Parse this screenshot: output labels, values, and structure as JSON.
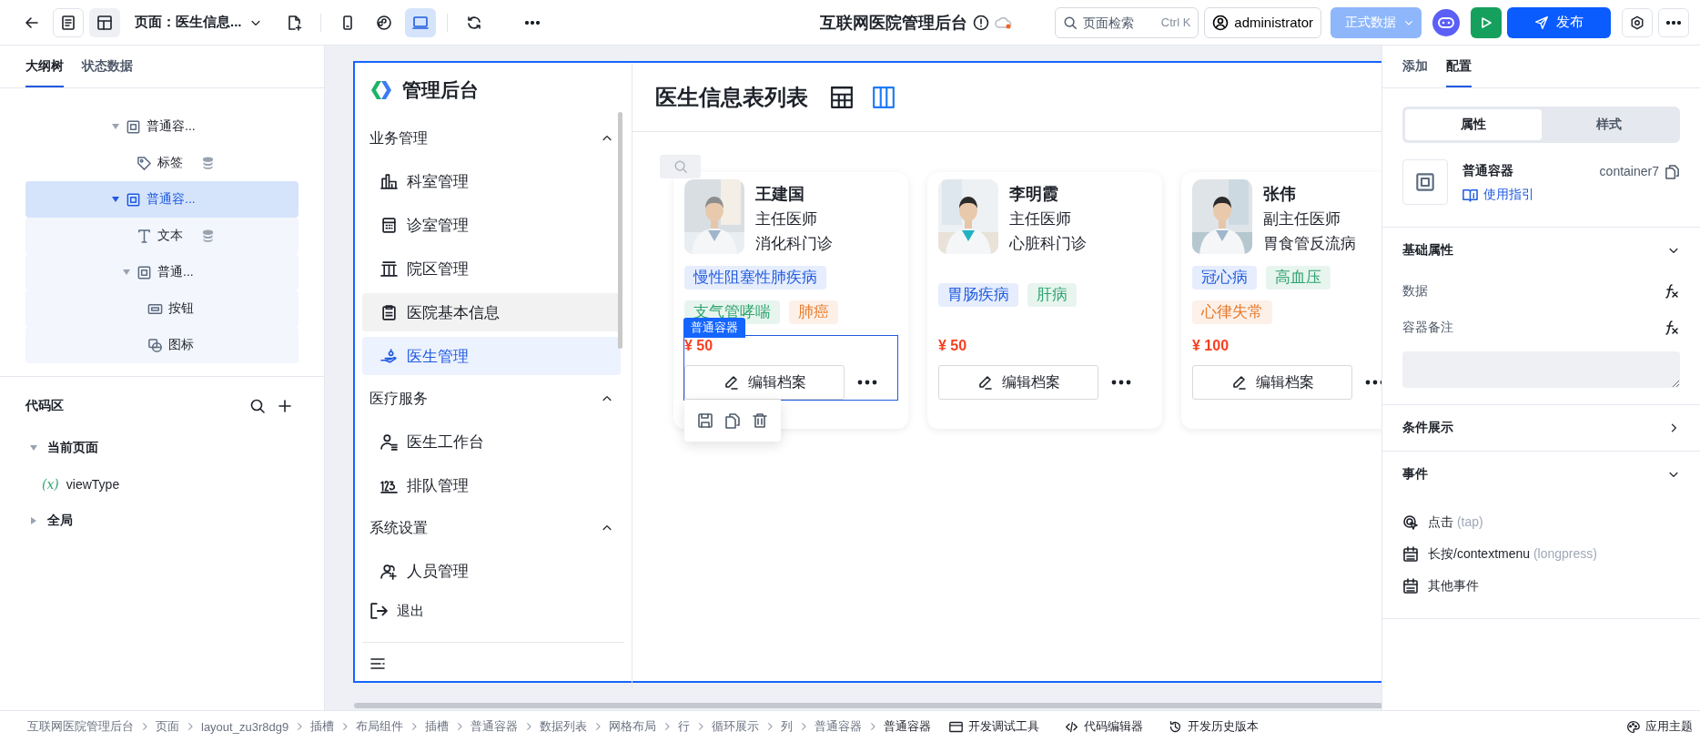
{
  "topbar": {
    "page_selector": "页面：医生信息...",
    "app_title": "互联网医院管理后台",
    "search": {
      "placeholder": "页面检索",
      "shortcut": "Ctrl K"
    },
    "user": "administrator",
    "env": "正式数据",
    "publish": "发布",
    "devices": [
      {
        "selected": false
      },
      {
        "selected": false
      },
      {
        "selected": true
      }
    ]
  },
  "left_panel": {
    "tabs": [
      {
        "label": "大纲树",
        "selected": true
      },
      {
        "label": "状态数据",
        "selected": false
      }
    ],
    "tree": [
      {
        "label": "普通容...",
        "kind": "container",
        "expanded": true,
        "selected": false,
        "bound": false,
        "children": [
          {
            "label": "标签",
            "kind": "tag",
            "selected": false,
            "bound": true
          }
        ]
      },
      {
        "label": "普通容...",
        "kind": "container",
        "expanded": true,
        "selected": true,
        "bound": false,
        "children": [
          {
            "label": "文本",
            "kind": "text",
            "selected": false,
            "bound": true
          },
          {
            "label": "普通...",
            "kind": "container",
            "expanded": true,
            "selected": false,
            "bound": false,
            "children": [
              {
                "label": "按钮",
                "kind": "button",
                "selected": false,
                "bound": false
              },
              {
                "label": "图标",
                "kind": "icon",
                "selected": false,
                "bound": false
              }
            ]
          }
        ]
      }
    ],
    "code_area": {
      "title": "代码区",
      "groups": [
        {
          "label": "当前页面",
          "expanded": true,
          "children": [
            {
              "icon": "(x)",
              "label": "viewType"
            }
          ]
        },
        {
          "label": "全局",
          "expanded": false
        }
      ]
    }
  },
  "app": {
    "brand": "管理后台",
    "menu": [
      {
        "label": "业务管理",
        "expanded": true,
        "items": [
          {
            "label": "科室管理",
            "selected": false,
            "hovered": false
          },
          {
            "label": "诊室管理",
            "selected": false,
            "hovered": false
          },
          {
            "label": "院区管理",
            "selected": false,
            "hovered": false
          },
          {
            "label": "医院基本信息",
            "selected": false,
            "hovered": true
          },
          {
            "label": "医生管理",
            "selected": true,
            "hovered": false
          }
        ]
      },
      {
        "label": "医疗服务",
        "expanded": true,
        "items": [
          {
            "label": "医生工作台",
            "selected": false,
            "hovered": false
          },
          {
            "label": "排队管理",
            "selected": false,
            "hovered": false
          }
        ]
      },
      {
        "label": "系统设置",
        "expanded": true,
        "items": [
          {
            "label": "人员管理",
            "selected": false,
            "hovered": false
          }
        ]
      }
    ],
    "logout": "退出",
    "page_title": "医生信息表列表",
    "view_modes": [
      {
        "selected": false
      },
      {
        "selected": true
      }
    ],
    "selection_label": "普通容器",
    "doctors": [
      {
        "name": "王建国",
        "title": "主任医师",
        "clinic": "消化科门诊",
        "price": "¥ 50",
        "edit_label": "编辑档案",
        "selected": true,
        "tags": [
          {
            "label": "慢性阻塞性肺疾病",
            "color": "#1f5ae0"
          },
          {
            "label": "支气管哮喘",
            "color": "#2ea36e"
          },
          {
            "label": "肺癌",
            "color": "#e8792b"
          }
        ]
      },
      {
        "name": "李明霞",
        "title": "主任医师",
        "clinic": "心脏科门诊",
        "price": "¥ 50",
        "edit_label": "编辑档案",
        "selected": false,
        "tags": [
          {
            "label": "胃肠疾病",
            "color": "#1f5ae0"
          },
          {
            "label": "肝病",
            "color": "#2ea36e"
          }
        ]
      },
      {
        "name": "张伟",
        "title": "副主任医师",
        "clinic": "胃食管反流病",
        "price": "¥ 100",
        "edit_label": "编辑档案",
        "selected": false,
        "tags": [
          {
            "label": "冠心病",
            "color": "#1f5ae0"
          },
          {
            "label": "高血压",
            "color": "#2ea36e"
          },
          {
            "label": "心律失常",
            "color": "#e8792b"
          }
        ]
      }
    ]
  },
  "right_panel": {
    "tabs": [
      {
        "label": "添加",
        "selected": false
      },
      {
        "label": "配置",
        "selected": true
      }
    ],
    "segments": [
      {
        "label": "属性",
        "selected": true
      },
      {
        "label": "样式",
        "selected": false
      }
    ],
    "component": {
      "name": "普通容器",
      "id": "container7",
      "guide": "使用指引"
    },
    "sections": [
      {
        "title": "基础属性",
        "expanded": true,
        "fields": [
          {
            "label": "数据"
          },
          {
            "label": "容器备注"
          }
        ]
      },
      {
        "title": "条件展示",
        "expanded": false
      },
      {
        "title": "事件",
        "expanded": true,
        "events": [
          {
            "label": "点击",
            "hint": "(tap)"
          },
          {
            "label": "长按/contextmenu",
            "hint": "(longpress)"
          },
          {
            "label": "其他事件"
          }
        ]
      }
    ]
  },
  "breadcrumb": [
    "互联网医院管理后台",
    "页面",
    "layout_zu3r8dg9",
    "插槽",
    "布局组件",
    "插槽",
    "普通容器",
    "数据列表",
    "网格布局",
    "行",
    "循环展示",
    "列",
    "普通容器",
    "普通容器"
  ],
  "footer_tools": [
    "开发调试工具",
    "代码编辑器",
    "开发历史版本",
    "应用主题"
  ]
}
